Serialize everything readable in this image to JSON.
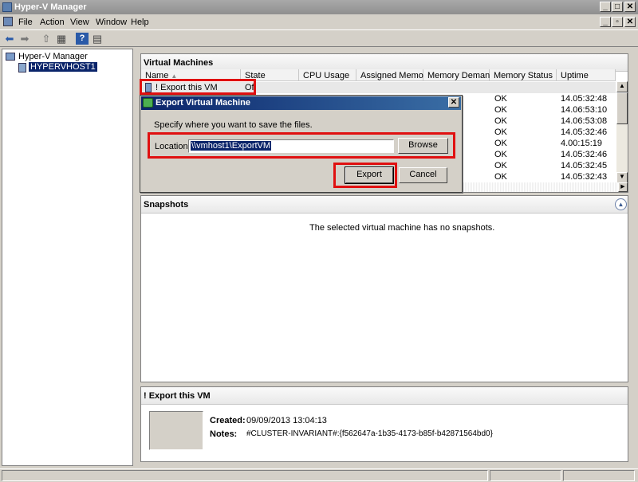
{
  "window": {
    "title": "Hyper-V Manager"
  },
  "menu": [
    "File",
    "Action",
    "View",
    "Window",
    "Help"
  ],
  "tree": {
    "root": "Hyper-V Manager",
    "host": "HYPERVHOST1"
  },
  "vm_panel": {
    "title": "Virtual Machines",
    "columns": [
      "Name",
      "State",
      "CPU Usage",
      "Assigned Memory",
      "Memory Demand",
      "Memory Status",
      "Uptime"
    ],
    "selected_row": {
      "name": "! Export this VM",
      "state": "Of"
    },
    "rows": [
      {
        "status": "OK",
        "uptime": "14.05:32:48"
      },
      {
        "status": "OK",
        "uptime": "14.06:53:10"
      },
      {
        "status": "OK",
        "uptime": "14.06:53:08"
      },
      {
        "status": "OK",
        "uptime": "14.05:32:46"
      },
      {
        "status": "OK",
        "uptime": "4.00:15:19"
      },
      {
        "status": "OK",
        "uptime": "14.05:32:46"
      },
      {
        "status": "OK",
        "uptime": "14.05:32:45"
      },
      {
        "status": "OK",
        "uptime": "14.05:32:43"
      }
    ]
  },
  "dialog": {
    "title": "Export Virtual Machine",
    "instruction": "Specify where you want to save the files.",
    "location_label": "Location:",
    "location_value": "\\\\vmhost1\\ExportVM",
    "browse_label": "Browse",
    "export_label": "Export",
    "cancel_label": "Cancel"
  },
  "snapshots": {
    "title": "Snapshots",
    "message": "The selected virtual machine has no snapshots."
  },
  "details": {
    "title": "! Export this VM",
    "created_label": "Created:",
    "created_value": "09/09/2013 13:04:13",
    "notes_label": "Notes:",
    "notes_value": "#CLUSTER-INVARIANT#:{f562647a-1b35-4173-b85f-b42871564bd0}"
  },
  "colors": {
    "highlight": "#0a246a",
    "annotation": "#e01010"
  }
}
